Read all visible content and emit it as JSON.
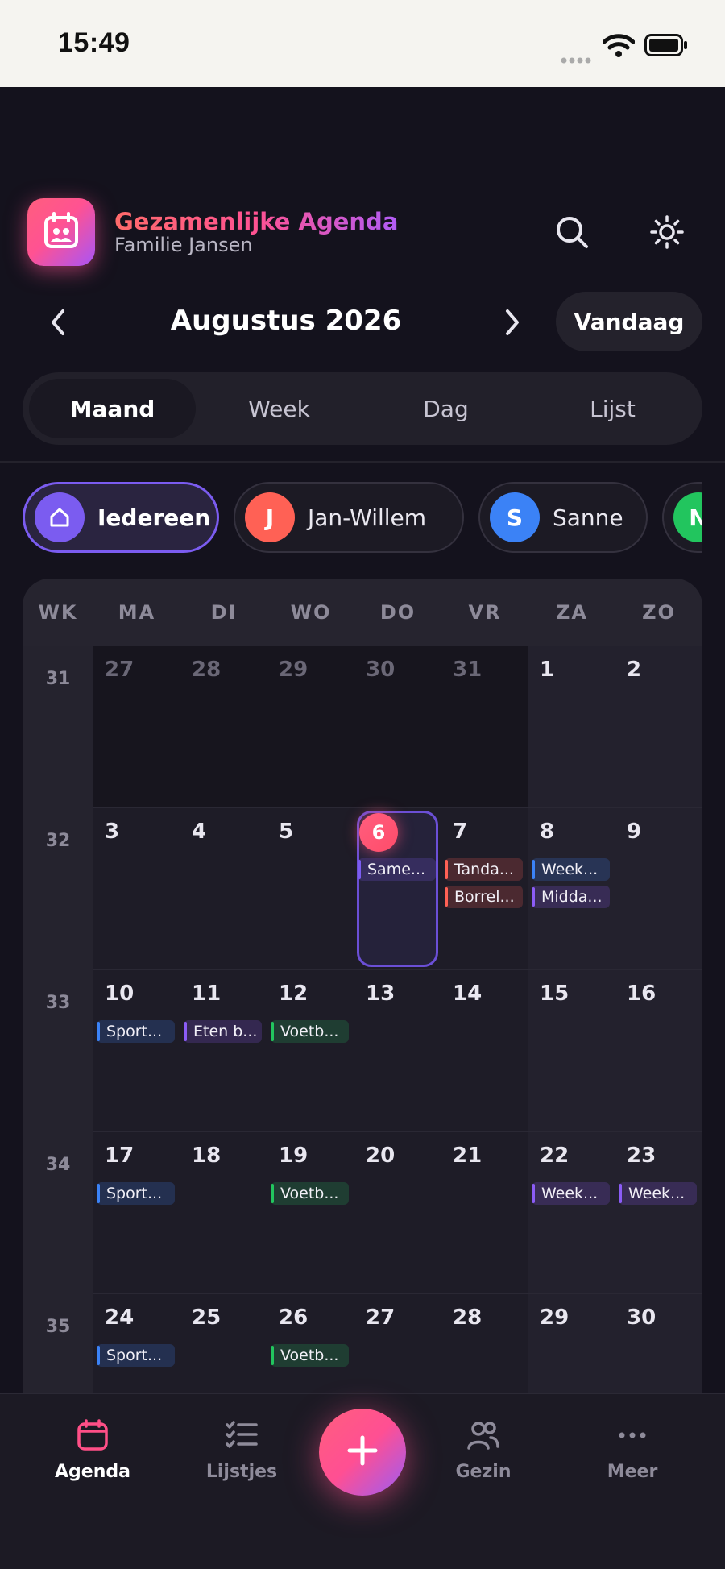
{
  "status_bar": {
    "time": "15:49"
  },
  "header": {
    "title": "Gezamenlijke Agenda",
    "subtitle": "Familie Jansen",
    "icons": [
      "calendar-family-icon",
      "search-icon",
      "sun-icon"
    ]
  },
  "month_nav": {
    "label": "Augustus 2026",
    "today_label": "Vandaag"
  },
  "view_tabs": [
    {
      "label": "Maand",
      "active": true
    },
    {
      "label": "Week",
      "active": false
    },
    {
      "label": "Dag",
      "active": false
    },
    {
      "label": "Lijst",
      "active": false
    }
  ],
  "filters": [
    {
      "label": "Iedereen",
      "initial": "",
      "color": "#7b5cf0",
      "icon": "home-icon",
      "active": true
    },
    {
      "label": "Jan-Willem",
      "initial": "J",
      "color": "#ff6155",
      "active": false
    },
    {
      "label": "Sanne",
      "initial": "S",
      "color": "#3b82f6",
      "active": false
    },
    {
      "label": "",
      "initial": "N",
      "color": "#22c55e",
      "active": false
    }
  ],
  "calendar": {
    "weekday_headers": [
      "WK",
      "MA",
      "DI",
      "WO",
      "DO",
      "VR",
      "ZA",
      "ZO"
    ],
    "weeks": [
      {
        "wk": "31",
        "days": [
          {
            "d": "27",
            "out": true
          },
          {
            "d": "28",
            "out": true
          },
          {
            "d": "29",
            "out": true
          },
          {
            "d": "30",
            "out": true
          },
          {
            "d": "31",
            "out": true
          },
          {
            "d": "1"
          },
          {
            "d": "2"
          }
        ]
      },
      {
        "wk": "32",
        "days": [
          {
            "d": "3"
          },
          {
            "d": "4"
          },
          {
            "d": "5"
          },
          {
            "d": "6",
            "today": true,
            "events": [
              {
                "t": "Same...",
                "c": "#7b5cf0"
              }
            ]
          },
          {
            "d": "7",
            "events": [
              {
                "t": "Tanda...",
                "c": "#ff6155"
              },
              {
                "t": "Borrel...",
                "c": "#ff6155"
              }
            ]
          },
          {
            "d": "8",
            "events": [
              {
                "t": "Week...",
                "c": "#3b82f6"
              },
              {
                "t": "Midda...",
                "c": "#8b5cf6"
              }
            ]
          },
          {
            "d": "9"
          }
        ]
      },
      {
        "wk": "33",
        "days": [
          {
            "d": "10",
            "events": [
              {
                "t": "Sport...",
                "c": "#3b82f6"
              }
            ]
          },
          {
            "d": "11",
            "events": [
              {
                "t": "Eten b...",
                "c": "#8b5cf6"
              }
            ]
          },
          {
            "d": "12",
            "events": [
              {
                "t": "Voetb...",
                "c": "#22c55e"
              }
            ]
          },
          {
            "d": "13"
          },
          {
            "d": "14"
          },
          {
            "d": "15"
          },
          {
            "d": "16"
          }
        ]
      },
      {
        "wk": "34",
        "days": [
          {
            "d": "17",
            "events": [
              {
                "t": "Sport...",
                "c": "#3b82f6"
              }
            ]
          },
          {
            "d": "18"
          },
          {
            "d": "19",
            "events": [
              {
                "t": "Voetb...",
                "c": "#22c55e"
              }
            ]
          },
          {
            "d": "20"
          },
          {
            "d": "21"
          },
          {
            "d": "22",
            "events": [
              {
                "t": "Week...",
                "c": "#8b5cf6"
              }
            ]
          },
          {
            "d": "23",
            "events": [
              {
                "t": "Week...",
                "c": "#8b5cf6"
              }
            ]
          }
        ]
      },
      {
        "wk": "35",
        "days": [
          {
            "d": "24",
            "events": [
              {
                "t": "Sport...",
                "c": "#3b82f6"
              }
            ]
          },
          {
            "d": "25"
          },
          {
            "d": "26",
            "events": [
              {
                "t": "Voetb...",
                "c": "#22c55e"
              }
            ]
          },
          {
            "d": "27"
          },
          {
            "d": "28"
          },
          {
            "d": "29"
          },
          {
            "d": "30"
          }
        ]
      }
    ]
  },
  "bottom_nav": [
    {
      "label": "Agenda",
      "icon": "calendar-icon",
      "active": true
    },
    {
      "label": "Lijstjes",
      "icon": "checklist-icon",
      "active": false
    },
    {
      "label": "",
      "icon": "plus-icon",
      "fab": true
    },
    {
      "label": "Gezin",
      "icon": "people-icon",
      "active": false
    },
    {
      "label": "Meer",
      "icon": "more-icon",
      "active": false
    }
  ],
  "colors": {
    "accent": "#ff5292",
    "purple": "#7b5cf0",
    "background": "#14121d"
  }
}
